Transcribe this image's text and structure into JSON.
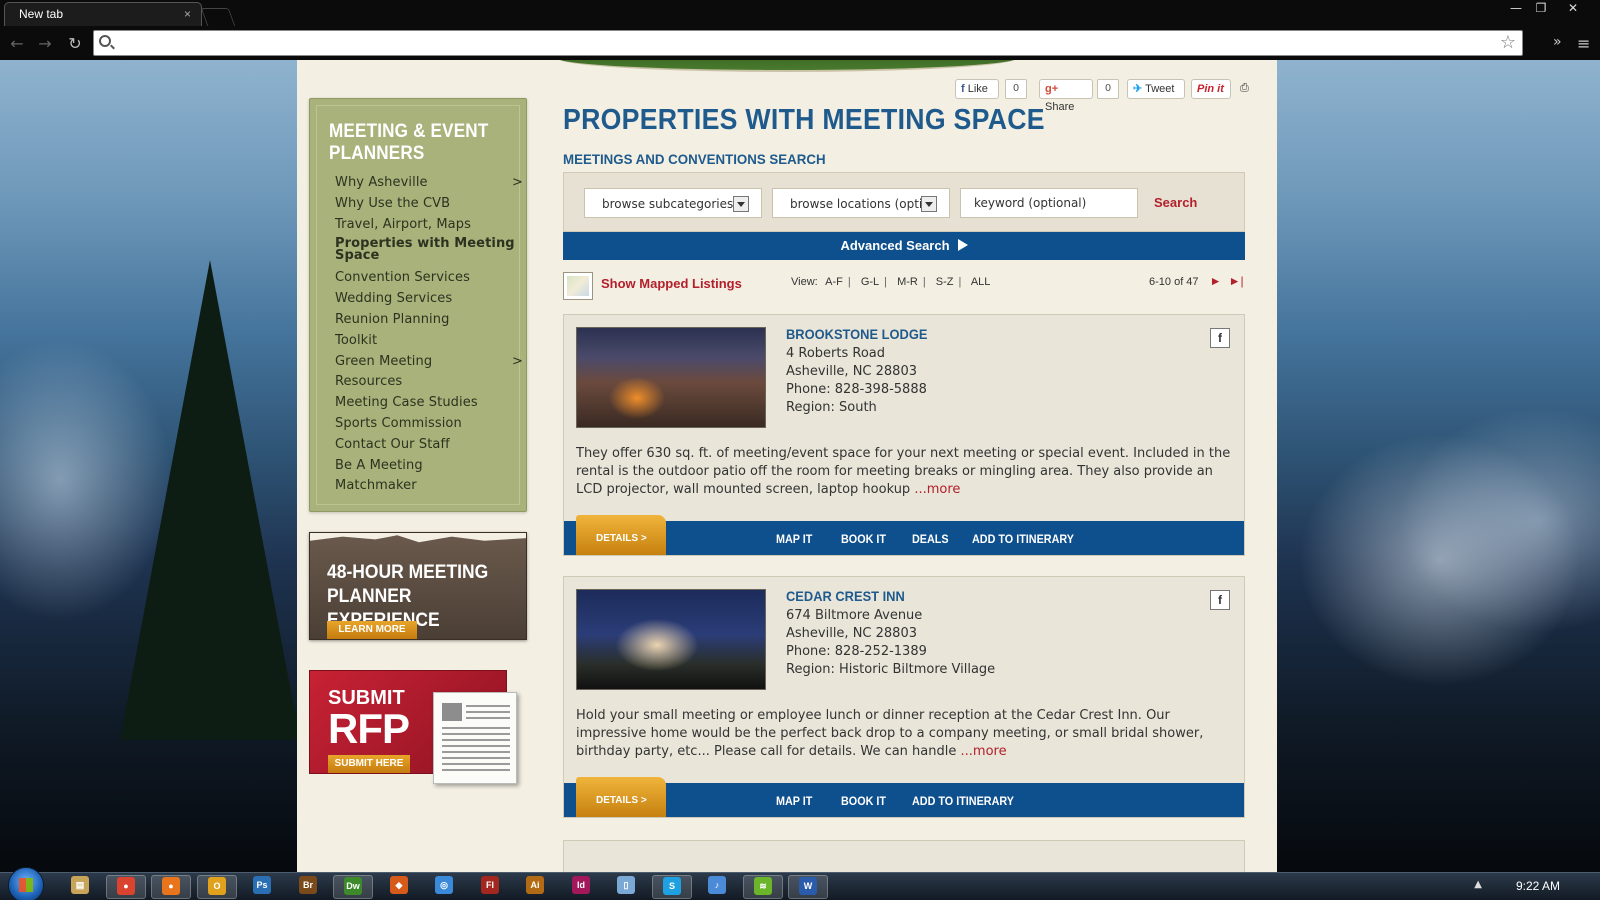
{
  "browser": {
    "tab_title": "New tab",
    "tab_close": "×",
    "address_value": "",
    "window_controls": [
      "—",
      "❐",
      "✕"
    ]
  },
  "social": {
    "like_label": "Like",
    "like_count": "0",
    "share_label": "Share",
    "share_count": "0",
    "tweet_label": "Tweet",
    "pin_label": "Pin it"
  },
  "sidebar": {
    "title": "MEETING & EVENT PLANNERS",
    "items": [
      {
        "label": "Why Asheville",
        "chevron": ">"
      },
      {
        "label": "Why Use the CVB"
      },
      {
        "label": "Travel, Airport, Maps"
      },
      {
        "label": "Properties with Meeting Space",
        "active": true
      },
      {
        "label": "Convention Services"
      },
      {
        "label": "Wedding Services"
      },
      {
        "label": "Reunion Planning"
      },
      {
        "label": "Toolkit"
      },
      {
        "label": "Green Meeting",
        "chevron": ">"
      },
      {
        "label": "Resources"
      },
      {
        "label": "Meeting Case Studies"
      },
      {
        "label": "Sports Commission"
      },
      {
        "label": "Contact Our Staff"
      },
      {
        "label": "Be A Meeting"
      },
      {
        "label": "Matchmaker"
      }
    ]
  },
  "promos": {
    "meeting48_title": "48-HOUR MEETING PLANNER EXPERIENCE",
    "learn_more": "LEARN MORE",
    "rfp_submit": "SUBMIT",
    "rfp_big": "RFP",
    "rfp_here": "SUBMIT HERE"
  },
  "main": {
    "title": "PROPERTIES WITH MEETING SPACE",
    "subtitle": "MEETINGS AND CONVENTIONS SEARCH",
    "search": {
      "subcategories": "browse subcategories",
      "locations": "browse locations (optic",
      "keyword_value": "keyword (optional)",
      "button": "Search"
    },
    "advanced_search": "Advanced Search",
    "show_mapped": "Show Mapped Listings",
    "view_label": "View:",
    "view_options": [
      "A-F",
      "G-L",
      "M-R",
      "S-Z",
      "ALL"
    ],
    "view_sep": "|",
    "pager_text": "6-10 of 47",
    "pager_next": "►",
    "pager_last": "►|"
  },
  "listings": [
    {
      "name": "BROOKSTONE LODGE",
      "address": "4 Roberts Road",
      "city": "Asheville, NC 28803",
      "phone": "Phone: 828-398-5888",
      "region": "Region: South",
      "description": "They offer 630 sq. ft. of meeting/event space for your next meeting or special event. Included in the rental is the outdoor patio off the room for meeting breaks or mingling area. They also provide an LCD projector, wall mounted screen, laptop hookup",
      "more": "...more",
      "details": "DETAILS >",
      "links": [
        "MAP IT",
        "BOOK IT",
        "DEALS",
        "ADD TO ITINERARY"
      ]
    },
    {
      "name": "CEDAR CREST INN",
      "address": "674 Biltmore Avenue",
      "city": "Asheville, NC 28803",
      "phone": "Phone: 828-252-1389",
      "region": "Region: Historic Biltmore Village",
      "description": "Hold your small meeting or employee lunch or dinner reception at the Cedar Crest Inn. Our impressive home would be the perfect back drop to a company meeting, or small bridal shower, birthday party, etc... Please call for details. We can handle",
      "more": "...more",
      "details": "DETAILS >",
      "links": [
        "MAP IT",
        "BOOK IT",
        "ADD TO ITINERARY"
      ]
    }
  ],
  "taskbar": {
    "clock": "9:22 AM",
    "apps": [
      {
        "name": "explorer",
        "glyph": "▤",
        "color": "#c8a45a"
      },
      {
        "name": "chrome",
        "glyph": "●",
        "color": "#d9432f",
        "active": true
      },
      {
        "name": "firefox",
        "glyph": "●",
        "color": "#e8741b",
        "active": true
      },
      {
        "name": "outlook",
        "glyph": "O",
        "color": "#e0a21c",
        "active": true
      },
      {
        "name": "photoshop",
        "glyph": "Ps",
        "color": "#2a6fb3"
      },
      {
        "name": "bridge",
        "glyph": "Br",
        "color": "#7a4a1a"
      },
      {
        "name": "dreamweaver",
        "glyph": "Dw",
        "color": "#3d8a2a",
        "active": true
      },
      {
        "name": "fireworks",
        "glyph": "◆",
        "color": "#d65a1a"
      },
      {
        "name": "network",
        "glyph": "◎",
        "color": "#3a8ad9"
      },
      {
        "name": "flash",
        "glyph": "Fl",
        "color": "#a3271f"
      },
      {
        "name": "illustrator",
        "glyph": "Ai",
        "color": "#b36a14"
      },
      {
        "name": "indesign",
        "glyph": "Id",
        "color": "#a2185a"
      },
      {
        "name": "notes",
        "glyph": "▯",
        "color": "#7aa9d6"
      },
      {
        "name": "skype",
        "glyph": "S",
        "color": "#1fa0e0",
        "active": true
      },
      {
        "name": "itunes",
        "glyph": "♪",
        "color": "#4a8ad6"
      },
      {
        "name": "spotify",
        "glyph": "≋",
        "color": "#6ab52a",
        "active": true
      },
      {
        "name": "word",
        "glyph": "W",
        "color": "#2b5cab",
        "active": true
      }
    ]
  }
}
